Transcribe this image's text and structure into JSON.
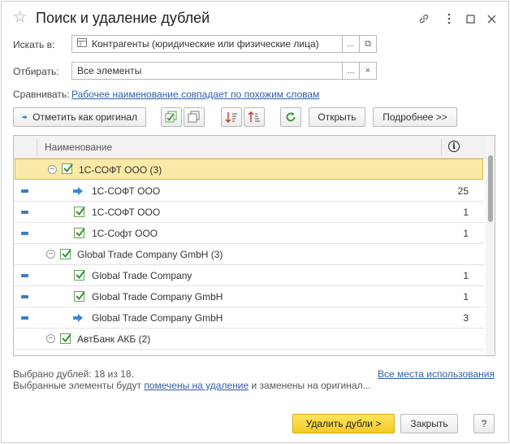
{
  "window": {
    "title": "Поиск и удаление дублей",
    "icons": {
      "link": "link-icon",
      "more": "more-vert-icon",
      "maximize": "maximize-icon",
      "close": "close-icon"
    }
  },
  "form": {
    "search_in": {
      "label": "Искать в:",
      "value": "Контрагенты (юридические или физические лица)",
      "select_btn": "...",
      "open_btn": "⧉"
    },
    "filter": {
      "label": "Отбирать:",
      "value": "Все элементы",
      "select_btn": "...",
      "clear_btn": "×"
    },
    "compare": {
      "label": "Сравнивать:",
      "link": "Рабочее наименование совпадает по похожим словам"
    }
  },
  "toolbar": {
    "mark_original": "Отметить как оригинал",
    "open": "Открыть",
    "more": "Подробнее >>"
  },
  "table": {
    "columns": {
      "name": "Наименование",
      "info_icon": "i"
    },
    "rows": [
      {
        "type": "group",
        "label": "1С-СОФТ ООО (3)",
        "selected": true
      },
      {
        "type": "item",
        "original": true,
        "label": "1С-СОФТ ООО",
        "count": "25"
      },
      {
        "type": "item",
        "original": false,
        "label": "1С-СОФТ ООО",
        "count": "1"
      },
      {
        "type": "item",
        "original": false,
        "label": "1С-Софт ООО",
        "count": "1"
      },
      {
        "type": "group",
        "label": "Global Trade Company GmbH (3)"
      },
      {
        "type": "item",
        "original": false,
        "label": "Global Trade Company",
        "count": "1"
      },
      {
        "type": "item",
        "original": false,
        "label": "Global Trade Company GmbH",
        "count": "1"
      },
      {
        "type": "item",
        "original": true,
        "label": "Global Trade Company GmbH",
        "count": "3"
      },
      {
        "type": "group",
        "label": "АвтБанк АКБ (2)"
      }
    ]
  },
  "footer": {
    "selected_text": "Выбрано дублей: 18 из 18.",
    "usage_link": "Все места использования",
    "note_before": "Выбранные элементы будут ",
    "note_link": "помечены на удаление",
    "note_after": " и заменены на оригинал..."
  },
  "buttons": {
    "delete": "Удалить дубли >",
    "close": "Закрыть",
    "help": "?"
  },
  "colors": {
    "accent_link": "#2f5ea8",
    "selected_row": "#fbe9a7",
    "primary_button": "#f6c928",
    "check": "#2e9a2e",
    "arrow": "#3b86d6"
  }
}
